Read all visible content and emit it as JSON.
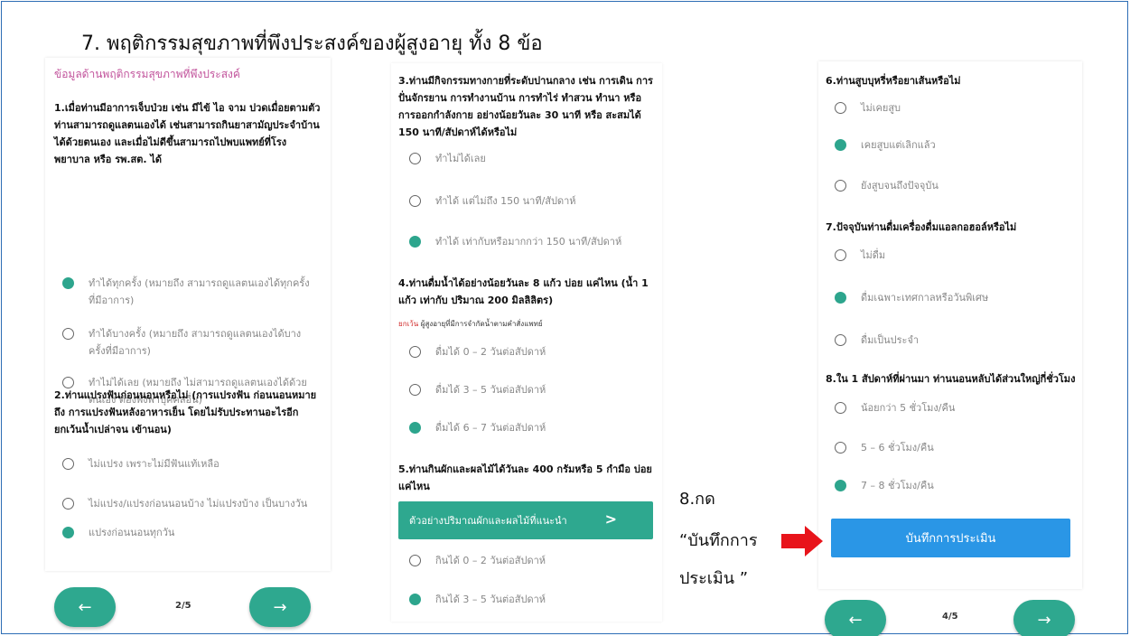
{
  "slide_title": "7. พฤติกรรมสุขภาพที่พึงประสงค์ของผู้สูงอายุ ทั้ง  8 ข้อ",
  "panel1": {
    "section_title": "ข้อมูลด้านพฤติกรรมสุขภาพที่พึงประสงค์",
    "q1": "1.เมื่อท่านมีอาการเจ็บป่วย เช่น มีไข้ ไอ จาม ปวดเมื่อยตามตัว ท่านสามารถดูแลตนเองได้ เช่นสามารถกินยาสามัญประจำบ้านได้ด้วยตนเอง และเมื่อไม่ดีขึ้นสามารถไปพบแพทย์ที่โรงพยาบาล หรือ รพ.สต. ได้",
    "q1_options": [
      {
        "label": "ทำได้ทุกครั้ง (หมายถึง สามารถดูแลตนเองได้ทุกครั้งที่มีอาการ)",
        "selected": true
      },
      {
        "label": "ทำได้บางครั้ง (หมายถึง สามารถดูแลตนเองได้บางครั้งที่มีอาการ)",
        "selected": false
      },
      {
        "label": "ทำไม่ได้เลย (หมายถึง ไม่สามารถดูแลตนเองได้ด้วยตนเอง ต้องพึ่งพาบุคคลอื่น)",
        "selected": false
      }
    ],
    "q2": "2.ท่านแปรงฟันก่อนนอนหรือไม่ (การแปรงฟัน ก่อนนอนหมายถึง การแปรงฟันหลังอาหารเย็น โดยไม่รับประทานอะไรอีก ยกเว้นน้ำเปล่าจน เข้านอน)",
    "q2_options": [
      {
        "label": "ไม่แปรง เพราะไม่มีฟันแท้เหลือ",
        "selected": false
      },
      {
        "label": "ไม่แปรง/แปรงก่อนนอนบ้าง ไม่แปรงบ้าง เป็นบางวัน",
        "selected": false
      },
      {
        "label": "แปรงก่อนนอนทุกวัน",
        "selected": true
      }
    ],
    "page": "2/5"
  },
  "panel2": {
    "q3": "3.ท่านมีกิจกรรมทางกายที่ระดับปานกลาง เช่น การเดิน การปั่นจักรยาน การทำงานบ้าน การทำไร่ ทำสวน ทำนา หรือการออกกำลังกาย อย่างน้อยวันละ 30 นาที หรือ สะสมได้ 150 นาที/สัปดาห์ได้หรือไม่",
    "q3_options": [
      {
        "label": "ทำไม่ได้เลย",
        "selected": false
      },
      {
        "label": "ทำได้ แต่ไม่ถึง 150 นาที/สัปดาห์",
        "selected": false
      },
      {
        "label": "ทำได้ เท่ากับหรือมากกว่า 150 นาที/สัปดาห์",
        "selected": true
      }
    ],
    "q4": "4.ท่านดื่มน้ำได้อย่างน้อยวันละ 8 แก้ว บ่อย แค่ไหน (น้ำ 1 แก้ว เท่ากับ ปริมาณ 200 มิลลิลิตร)",
    "q4_note_red": "ยกเว้น",
    "q4_note": " ผู้สูงอายุที่มีการจำกัดน้ำตามคำสั่งแพทย์",
    "q4_options": [
      {
        "label": "ดื่มได้ 0 – 2 วันต่อสัปดาห์",
        "selected": false
      },
      {
        "label": "ดื่มได้ 3 – 5 วันต่อสัปดาห์",
        "selected": false
      },
      {
        "label": "ดื่มได้ 6 – 7 วันต่อสัปดาห์",
        "selected": true
      }
    ],
    "q5": "5.ท่านกินผักและผลไม้ได้วันละ 400 กรัมหรือ 5 กำมือ บ่อยแค่ไหน",
    "tip_button": "ตัวอย่างปริมาณผักและผลไม้ที่แนะนำ",
    "tip_chevron": ">",
    "q5_options": [
      {
        "label": "กินได้ 0 – 2 วันต่อสัปดาห์",
        "selected": false
      },
      {
        "label": "กินได้ 3 – 5 วันต่อสัปดาห์",
        "selected": true
      }
    ]
  },
  "panel3": {
    "q6": "6.ท่านสูบบุหรี่หรือยาเส้นหรือไม่",
    "q6_options": [
      {
        "label": "ไม่เคยสูบ",
        "selected": false
      },
      {
        "label": "เคยสูบแต่เลิกแล้ว",
        "selected": true
      },
      {
        "label": "ยังสูบจนถึงปัจจุบัน",
        "selected": false
      }
    ],
    "q7": "7.ปัจจุบันท่านดื่มเครื่องดื่มแอลกอฮอล์หรือไม่",
    "q7_options": [
      {
        "label": "ไม่ดื่ม",
        "selected": false
      },
      {
        "label": "ดื่มเฉพาะเทศกาลหรือวันพิเศษ",
        "selected": true
      },
      {
        "label": "ดื่มเป็นประจำ",
        "selected": false
      }
    ],
    "q8": "8.ใน 1 สัปดาห์ที่ผ่านมา ท่านนอนหลับได้ส่วนใหญ่กี่ชั่วโมง",
    "q8_options": [
      {
        "label": "น้อยกว่า 5 ชั่วโมง/คืน",
        "selected": false
      },
      {
        "label": "5 – 6 ชั่วโมง/คืน",
        "selected": false
      },
      {
        "label": "7 – 8 ชั่วโมง/คืน",
        "selected": true
      }
    ],
    "save_button": "บันทึกการประเมิน",
    "page": "4/5"
  },
  "nav": {
    "prev": "←",
    "next": "→"
  },
  "callout": {
    "line1": "8.กด",
    "line2": "“บันทึกการ",
    "line3": "ประเมิน ”"
  },
  "colors": {
    "accent": "#2ea88f",
    "save": "#2a96e6",
    "arrow": "#e8141b",
    "section_title": "#c2549c"
  }
}
